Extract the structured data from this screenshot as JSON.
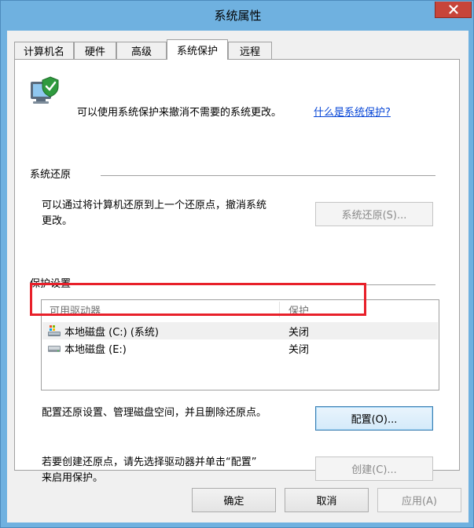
{
  "window": {
    "title": "系统属性",
    "close_label": "×"
  },
  "tabs": [
    {
      "label": "计算机名"
    },
    {
      "label": "硬件"
    },
    {
      "label": "高级"
    },
    {
      "label": "系统保护",
      "active": true
    },
    {
      "label": "远程"
    }
  ],
  "intro": {
    "text": "可以使用系统保护来撤消不需要的系统更改。",
    "link": "什么是系统保护?"
  },
  "restore": {
    "header": "系统还原",
    "desc_line1": "可以通过将计算机还原到上一个还原点，撤消系统",
    "desc_line2": "更改。",
    "button": "系统还原(S)..."
  },
  "protection": {
    "header": "保护设置",
    "col_drive": "可用驱动器",
    "col_protect": "保护",
    "drives": [
      {
        "name": "本地磁盘 (C:) (系统)",
        "protection": "关闭"
      },
      {
        "name": "本地磁盘 (E:)",
        "protection": "关闭"
      }
    ],
    "config_desc": "配置还原设置、管理磁盘空间，并且删除还原点。",
    "config_button": "配置(O)...",
    "create_desc_line1": "若要创建还原点，请先选择驱动器并单击“配置”",
    "create_desc_line2": "来启用保护。",
    "create_button": "创建(C)..."
  },
  "footer": {
    "ok": "确定",
    "cancel": "取消",
    "apply": "应用(A)"
  },
  "colors": {
    "accent": "#6fb1e0",
    "highlight": "#e8202a",
    "link": "#0645d6",
    "close": "#c7453a"
  }
}
